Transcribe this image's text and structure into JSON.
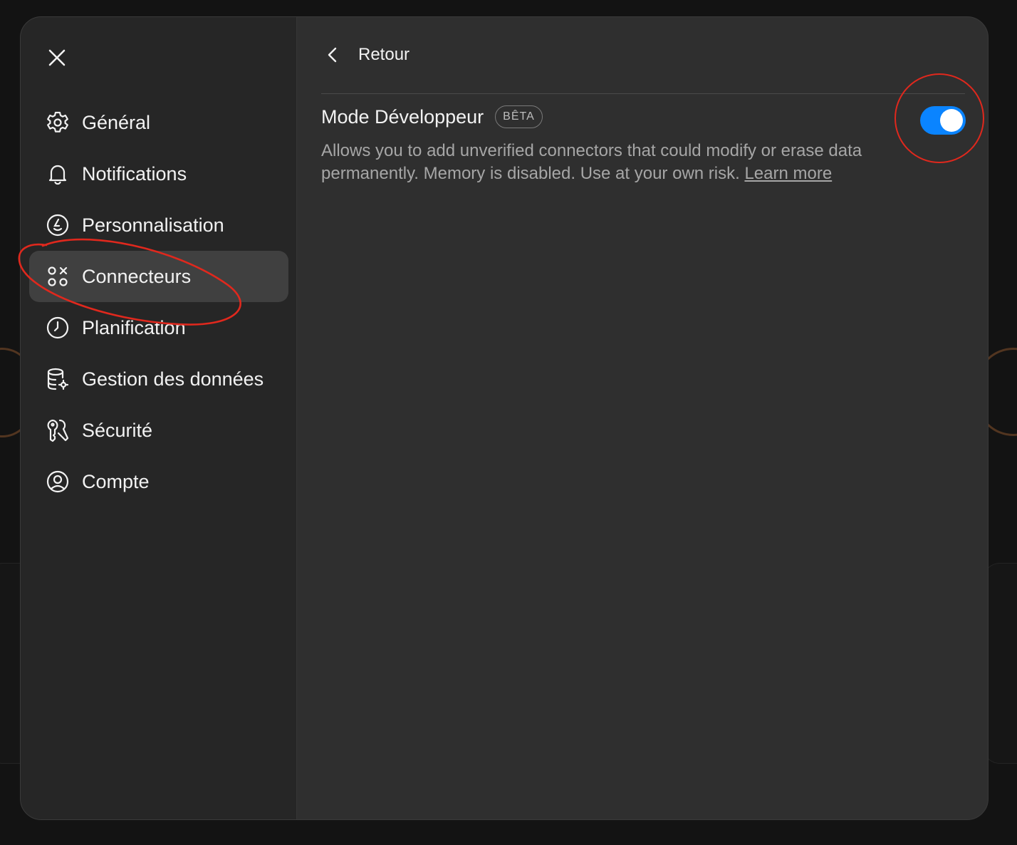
{
  "sidebar": {
    "close_icon": "close-icon",
    "items": [
      {
        "id": "general",
        "label": "Général",
        "icon": "gear-icon",
        "active": false
      },
      {
        "id": "notifications",
        "label": "Notifications",
        "icon": "bell-icon",
        "active": false
      },
      {
        "id": "personnalisation",
        "label": "Personnalisation",
        "icon": "personalization-icon",
        "active": false
      },
      {
        "id": "connecteurs",
        "label": "Connecteurs",
        "icon": "connectors-icon",
        "active": true
      },
      {
        "id": "planification",
        "label": "Planification",
        "icon": "clock-icon",
        "active": false
      },
      {
        "id": "gestion",
        "label": "Gestion des données",
        "icon": "database-gear-icon",
        "active": false
      },
      {
        "id": "securite",
        "label": "Sécurité",
        "icon": "security-icon",
        "active": false
      },
      {
        "id": "compte",
        "label": "Compte",
        "icon": "user-circle-icon",
        "active": false
      }
    ]
  },
  "content": {
    "back_label": "Retour",
    "setting": {
      "title": "Mode Développeur",
      "badge": "BÊTA",
      "description": "Allows you to add unverified connectors that could modify or erase data permanently. Memory is disabled. Use at your own risk.",
      "link_label": "Learn more",
      "enabled": true
    }
  },
  "colors": {
    "accent": "#0a84ff",
    "annotation": "#e0281d",
    "modal_bg": "#2f2f2f",
    "sidebar_bg": "#262626"
  }
}
